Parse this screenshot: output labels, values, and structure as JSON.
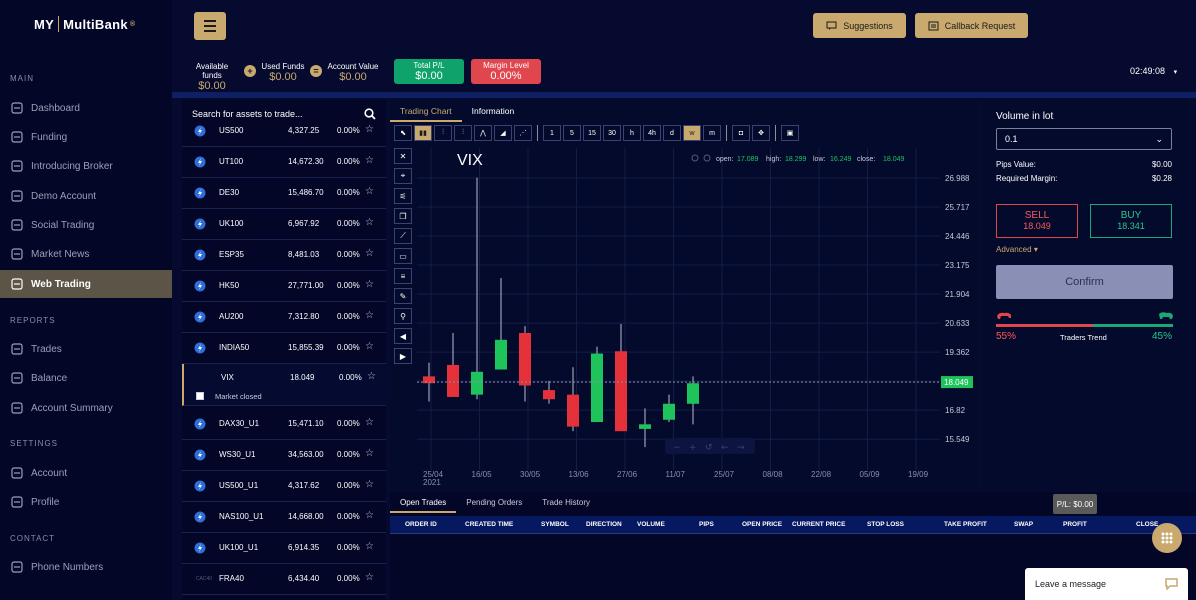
{
  "brand": {
    "my": "MY",
    "name": "MultiBank",
    "mark": "®"
  },
  "sidebar": {
    "main_label": "MAIN",
    "items": [
      {
        "label": "Dashboard",
        "icon": "dashboard-icon"
      },
      {
        "label": "Funding",
        "icon": "funding-icon"
      },
      {
        "label": "Introducing Broker",
        "icon": "broker-icon"
      },
      {
        "label": "Demo Account",
        "icon": "demo-account-icon"
      },
      {
        "label": "Social Trading",
        "icon": "social-trading-icon"
      },
      {
        "label": "Market News",
        "icon": "news-icon"
      },
      {
        "label": "Web Trading",
        "icon": "web-trading-icon",
        "active": true
      }
    ],
    "reports_label": "REPORTS",
    "reports": [
      {
        "label": "Trades",
        "icon": "trades-icon"
      },
      {
        "label": "Balance",
        "icon": "balance-icon"
      },
      {
        "label": "Account Summary",
        "icon": "account-summary-icon"
      }
    ],
    "settings_label": "SETTINGS",
    "settings": [
      {
        "label": "Account",
        "icon": "account-icon"
      },
      {
        "label": "Profile",
        "icon": "profile-icon"
      }
    ],
    "contact_label": "CONTACT",
    "contact": [
      {
        "label": "Phone Numbers",
        "icon": "phone-icon"
      }
    ]
  },
  "header": {
    "suggestions": "Suggestions",
    "callback": "Callback Request",
    "available_funds_label": "Available funds",
    "available_funds": "$0.00",
    "used_funds_label": "Used Funds",
    "used_funds": "$0.00",
    "account_value_label": "Account Value",
    "account_value": "$0.00",
    "plus": "+",
    "equals": "=",
    "total_pl_label": "Total P/L",
    "total_pl": "$0.00",
    "margin_level_label": "Margin Level",
    "margin_level": "0.00%",
    "time": "02:49:08",
    "colors": {
      "accent": "#c9a96e",
      "green": "#0fa36b",
      "red": "#e0464d",
      "bg": "#050a2e"
    }
  },
  "assets": {
    "search_placeholder": "Search for assets to trade...",
    "rows": [
      {
        "symbol": "US500",
        "price": "4,327.25",
        "change": "0.00%"
      },
      {
        "symbol": "UT100",
        "price": "14,672.30",
        "change": "0.00%"
      },
      {
        "symbol": "DE30",
        "price": "15,486.70",
        "change": "0.00%"
      },
      {
        "symbol": "UK100",
        "price": "6,967.92",
        "change": "0.00%"
      },
      {
        "symbol": "ESP35",
        "price": "8,481.03",
        "change": "0.00%"
      },
      {
        "symbol": "HK50",
        "price": "27,771.00",
        "change": "0.00%"
      },
      {
        "symbol": "AU200",
        "price": "7,312.80",
        "change": "0.00%"
      },
      {
        "symbol": "INDIA50",
        "price": "15,855.39",
        "change": "0.00%"
      },
      {
        "symbol": "VIX",
        "price": "18.049",
        "change": "0.00%",
        "status": "Market closed"
      },
      {
        "symbol": "DAX30_U1",
        "price": "15,471.10",
        "change": "0.00%"
      },
      {
        "symbol": "WS30_U1",
        "price": "34,563.00",
        "change": "0.00%"
      },
      {
        "symbol": "US500_U1",
        "price": "4,317.62",
        "change": "0.00%"
      },
      {
        "symbol": "NAS100_U1",
        "price": "14,668.00",
        "change": "0.00%"
      },
      {
        "symbol": "UK100_U1",
        "price": "6,914.35",
        "change": "0.00%"
      },
      {
        "symbol": "FRA40",
        "price": "6,434.40",
        "change": "0.00%",
        "icon_text": "CAC40"
      }
    ]
  },
  "chart": {
    "tabs": [
      "Trading Chart",
      "Information"
    ],
    "symbol": "VIX",
    "ohlc": {
      "open_label": "open:",
      "open": "17.089",
      "high_label": "high:",
      "high": "18.299",
      "low_label": "low:",
      "low": "16.249",
      "close_label": "close:",
      "close": "18.049"
    },
    "timeframes": [
      "1",
      "5",
      "15",
      "30",
      "h",
      "4h",
      "d",
      "w",
      "m"
    ],
    "active_timeframe": "w"
  },
  "chart_data": {
    "type": "candlestick",
    "symbol": "VIX",
    "y_ticks": [
      26.988,
      25.717,
      24.446,
      23.175,
      21.904,
      20.633,
      19.362,
      18.091,
      16.82,
      15.549
    ],
    "ylim": [
      14.2,
      28.3
    ],
    "x_ticks": [
      "25/04",
      "16/05",
      "30/05",
      "13/06",
      "27/06",
      "11/07",
      "25/07",
      "08/08",
      "22/08",
      "05/09",
      "19/09"
    ],
    "x_year": "2021",
    "current_price": "18.049",
    "candles": [
      {
        "date": "04/2021",
        "open": 18.3,
        "high": 18.9,
        "low": 17.2,
        "close": 18.0
      },
      {
        "date": "04/2021",
        "open": 18.8,
        "high": 20.2,
        "low": 17.4,
        "close": 17.4
      },
      {
        "date": "05/2021",
        "open": 17.5,
        "high": 27.0,
        "low": 17.3,
        "close": 18.5
      },
      {
        "date": "05/2021",
        "open": 18.6,
        "high": 22.6,
        "low": 18.6,
        "close": 19.9
      },
      {
        "date": "05/2021",
        "open": 20.2,
        "high": 20.5,
        "low": 17.2,
        "close": 17.9
      },
      {
        "date": "06/2021",
        "open": 17.7,
        "high": 18.1,
        "low": 17.1,
        "close": 17.3
      },
      {
        "date": "06/2021",
        "open": 17.5,
        "high": 18.7,
        "low": 15.9,
        "close": 16.1
      },
      {
        "date": "06/2021",
        "open": 16.3,
        "high": 19.6,
        "low": 16.3,
        "close": 19.3
      },
      {
        "date": "06/2021",
        "open": 19.4,
        "high": 20.6,
        "low": 15.9,
        "close": 15.9
      },
      {
        "date": "07/2021",
        "open": 16.0,
        "high": 16.9,
        "low": 15.2,
        "close": 16.2
      },
      {
        "date": "07/2021",
        "open": 16.4,
        "high": 17.5,
        "low": 16.3,
        "close": 17.1
      },
      {
        "date": "07/2021",
        "open": 17.1,
        "high": 18.3,
        "low": 16.2,
        "close": 18.0
      }
    ]
  },
  "bottom": {
    "tabs": [
      "Open Trades",
      "Pending Orders",
      "Trade History"
    ],
    "pl_label": "P/L:",
    "pl_value": "$0.00",
    "columns": [
      "ORDER ID",
      "CREATED TIME",
      "SYMBOL",
      "DIRECTION",
      "VOLUME",
      "PIPS",
      "OPEN PRICE",
      "CURRENT PRICE",
      "STOP LOSS",
      "TAKE PROFIT",
      "SWAP",
      "PROFIT",
      "CLOSE"
    ]
  },
  "order": {
    "volume_label": "Volume in lot",
    "volume": "0.1",
    "pips_label": "Pips Value:",
    "pips_value": "$0.00",
    "margin_label": "Required Margin:",
    "margin_value": "$0.28",
    "sell_label": "SELL",
    "sell_price": "18.049",
    "buy_label": "BUY",
    "buy_price": "18.341",
    "advanced": "Advanced",
    "confirm": "Confirm",
    "bear_pct": "55%",
    "trend_label": "Traders Trend",
    "bull_pct": "45%",
    "bear_ratio": 0.55
  },
  "chat": {
    "leave_message": "Leave a message"
  }
}
